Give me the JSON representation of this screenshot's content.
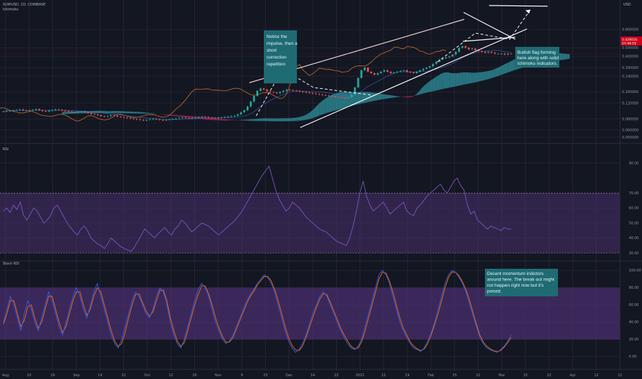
{
  "header": {
    "symbol": "XLM/USD, 1D, COINBASE",
    "indicator": "Ichimoku",
    "currency": "USD",
    "rsi_label": "RSI",
    "stoch_label": "Stoch RSI"
  },
  "price_label": {
    "price": "0.429016",
    "countdown": "07:46:55"
  },
  "annotations": [
    {
      "id": "impulse",
      "lines": [
        "Notice the",
        "impulse, then a",
        "short",
        "correction",
        "repetition"
      ]
    },
    {
      "id": "flag",
      "lines": [
        "Bullish flag forming",
        "here along with solid",
        "Ichimoku indicators."
      ]
    },
    {
      "id": "momentum",
      "lines": [
        "Decent momentum indictors",
        "around here. The break out might",
        "not happen right now but it's",
        "poised."
      ]
    }
  ],
  "colors": {
    "background": "#131722",
    "grid": "#3a2a3d",
    "up_candle": "#26a69a",
    "down_candle": "#ef5350",
    "cloud_bull": "#2d8a96",
    "cloud_bear": "#a0235b",
    "rsi_line": "#7e57c2",
    "rsi_band": "#4a2f6e",
    "stoch_k": "#2962ff",
    "stoch_d": "#ff6d00",
    "note_bg": "#1f6b73",
    "price_tag": "#d0021b"
  },
  "chart_data": [
    {
      "type": "candlestick",
      "title": "XLM/USD, 1D, COINBASE",
      "scale": "log",
      "ylim": [
        0.045,
        1.2
      ],
      "y_ticks": [
        {
          "v": 0.8,
          "label": "0.800000"
        },
        {
          "v": 0.5,
          "label": "0.500000"
        },
        {
          "v": 0.4,
          "label": "0.400000"
        },
        {
          "v": 0.3,
          "label": "0.300000"
        },
        {
          "v": 0.24,
          "label": "0.240000"
        },
        {
          "v": 0.16,
          "label": "0.160000"
        },
        {
          "v": 0.12,
          "label": "0.120000"
        },
        {
          "v": 0.08,
          "label": "0.080000"
        },
        {
          "v": 0.06,
          "label": "0.060000"
        },
        {
          "v": 0.05,
          "label": "0.050000"
        }
      ],
      "x_ticks": [
        "Aug",
        "10",
        "24",
        "Sep",
        "14",
        "22",
        "Oct",
        "12",
        "26",
        "Nov",
        "9",
        "23",
        "Dec",
        "14",
        "22",
        "2021",
        "11",
        "19",
        "Feb",
        "15",
        "22",
        "Mar",
        "15",
        "22",
        "Apr",
        "12",
        "22"
      ],
      "close": [
        0.097,
        0.099,
        0.098,
        0.1,
        0.101,
        0.102,
        0.1,
        0.099,
        0.1,
        0.101,
        0.103,
        0.1,
        0.098,
        0.097,
        0.099,
        0.1,
        0.102,
        0.101,
        0.099,
        0.098,
        0.097,
        0.095,
        0.094,
        0.096,
        0.097,
        0.095,
        0.093,
        0.091,
        0.09,
        0.088,
        0.086,
        0.085,
        0.086,
        0.088,
        0.087,
        0.085,
        0.084,
        0.083,
        0.082,
        0.081,
        0.08,
        0.079,
        0.078,
        0.077,
        0.078,
        0.079,
        0.08,
        0.079,
        0.078,
        0.077,
        0.078,
        0.079,
        0.08,
        0.081,
        0.082,
        0.083,
        0.082,
        0.081,
        0.082,
        0.083,
        0.084,
        0.085,
        0.084,
        0.083,
        0.082,
        0.081,
        0.082,
        0.083,
        0.084,
        0.085,
        0.086,
        0.087,
        0.09,
        0.095,
        0.1,
        0.11,
        0.125,
        0.145,
        0.165,
        0.175,
        0.17,
        0.163,
        0.16,
        0.158,
        0.155,
        0.16,
        0.165,
        0.17,
        0.168,
        0.166,
        0.164,
        0.162,
        0.16,
        0.158,
        0.156,
        0.154,
        0.152,
        0.15,
        0.148,
        0.146,
        0.145,
        0.143,
        0.141,
        0.14,
        0.138,
        0.137,
        0.14,
        0.15,
        0.18,
        0.23,
        0.28,
        0.3,
        0.27,
        0.26,
        0.25,
        0.26,
        0.27,
        0.28,
        0.27,
        0.26,
        0.265,
        0.27,
        0.275,
        0.28,
        0.27,
        0.265,
        0.26,
        0.27,
        0.28,
        0.29,
        0.3,
        0.31,
        0.33,
        0.35,
        0.37,
        0.38,
        0.39,
        0.4,
        0.42,
        0.45,
        0.5,
        0.52,
        0.5,
        0.48,
        0.49,
        0.47,
        0.46,
        0.45,
        0.44,
        0.45,
        0.44,
        0.43,
        0.43,
        0.43,
        0.42,
        0.43,
        0.429
      ]
    },
    {
      "type": "line",
      "title": "RSI",
      "ylim": [
        25,
        100
      ],
      "y_ticks": [
        90,
        70,
        60,
        50,
        40,
        30
      ],
      "bands": [
        70,
        30
      ],
      "values": [
        58,
        60,
        57,
        62,
        59,
        64,
        55,
        52,
        56,
        60,
        58,
        54,
        50,
        52,
        55,
        60,
        62,
        58,
        54,
        50,
        47,
        44,
        42,
        46,
        48,
        45,
        40,
        38,
        36,
        35,
        33,
        36,
        40,
        38,
        36,
        34,
        33,
        32,
        31,
        34,
        38,
        42,
        46,
        44,
        42,
        40,
        43,
        45,
        47,
        44,
        42,
        46,
        48,
        52,
        50,
        47,
        44,
        46,
        48,
        50,
        49,
        48,
        46,
        44,
        42,
        44,
        46,
        48,
        50,
        52,
        55,
        58,
        62,
        66,
        70,
        74,
        78,
        82,
        85,
        88,
        80,
        72,
        66,
        62,
        58,
        60,
        64,
        62,
        60,
        57,
        54,
        52,
        50,
        48,
        46,
        45,
        44,
        42,
        40,
        38,
        37,
        36,
        35,
        40,
        48,
        58,
        70,
        78,
        68,
        62,
        58,
        60,
        62,
        64,
        60,
        56,
        58,
        60,
        62,
        64,
        58,
        56,
        55,
        60,
        62,
        65,
        68,
        70,
        72,
        74,
        76,
        72,
        70,
        74,
        78,
        80,
        75,
        72,
        62,
        56,
        58,
        52,
        50,
        48,
        46,
        48,
        47,
        46,
        45,
        47,
        46,
        46
      ]
    },
    {
      "type": "line",
      "title": "Stoch RSI",
      "ylim": [
        -10,
        110
      ],
      "y_ticks": [
        100,
        80,
        60,
        40,
        20,
        0
      ],
      "bands": [
        80,
        20
      ],
      "series": [
        {
          "values": [
            40,
            55,
            70,
            60,
            45,
            30,
            50,
            65,
            55,
            40,
            30,
            45,
            60,
            75,
            65,
            50,
            35,
            25,
            40,
            55,
            70,
            80,
            70,
            55,
            45,
            60,
            75,
            85,
            70,
            55,
            40,
            25,
            15,
            10,
            20,
            35,
            50,
            65,
            75,
            70,
            60,
            50,
            45,
            55,
            70,
            80,
            75,
            60,
            40,
            25,
            15,
            10,
            20,
            35,
            50,
            65,
            78,
            85,
            80,
            70,
            55,
            40,
            30,
            20,
            15,
            18,
            25,
            35,
            45,
            55,
            65,
            72,
            78,
            85,
            90,
            95,
            92,
            85,
            75,
            60,
            45,
            30,
            18,
            10,
            5,
            8,
            15,
            25,
            38,
            50,
            60,
            70,
            75,
            70,
            60,
            50,
            40,
            30,
            22,
            15,
            10,
            8,
            12,
            20,
            35,
            50,
            65,
            80,
            95,
            100,
            95,
            85,
            70,
            55,
            40,
            30,
            22,
            15,
            10,
            8,
            6,
            10,
            18,
            28,
            40,
            55,
            70,
            85,
            95,
            100,
            98,
            92,
            85,
            75,
            62,
            48,
            35,
            22,
            15,
            10,
            8,
            6,
            5,
            8,
            12,
            18,
            25
          ]
        },
        {
          "values": [
            38,
            50,
            65,
            65,
            50,
            35,
            42,
            58,
            60,
            45,
            33,
            40,
            55,
            70,
            70,
            55,
            40,
            28,
            35,
            50,
            65,
            75,
            75,
            60,
            48,
            55,
            70,
            80,
            75,
            60,
            45,
            30,
            18,
            12,
            15,
            28,
            45,
            60,
            72,
            73,
            63,
            53,
            47,
            52,
            65,
            77,
            77,
            65,
            45,
            30,
            18,
            12,
            16,
            30,
            45,
            60,
            72,
            82,
            82,
            73,
            60,
            45,
            33,
            23,
            17,
            17,
            22,
            32,
            42,
            52,
            62,
            70,
            76,
            83,
            88,
            93,
            93,
            88,
            78,
            65,
            50,
            35,
            22,
            13,
            8,
            7,
            12,
            22,
            34,
            46,
            57,
            67,
            73,
            72,
            63,
            53,
            43,
            33,
            25,
            18,
            12,
            9,
            10,
            17,
            30,
            45,
            60,
            75,
            90,
            98,
            97,
            88,
            75,
            60,
            45,
            33,
            25,
            17,
            12,
            9,
            7,
            9,
            15,
            25,
            37,
            50,
            65,
            80,
            92,
            98,
            98,
            94,
            87,
            78,
            66,
            52,
            38,
            25,
            17,
            12,
            9,
            7,
            6,
            7,
            11,
            16,
            22
          ]
        }
      ]
    }
  ]
}
